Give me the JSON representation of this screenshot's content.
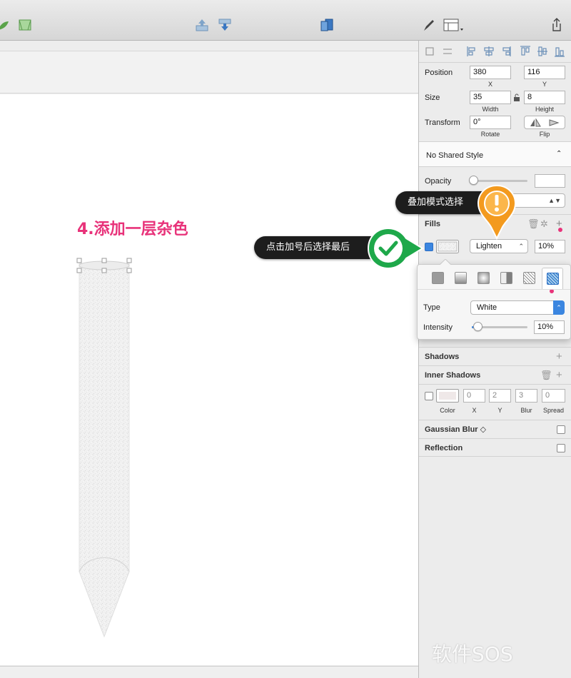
{
  "canvas": {
    "title": "4.添加一层杂色"
  },
  "tooltips": {
    "blend": "叠加模式选择",
    "add": "点击加号后选择最后"
  },
  "inspector": {
    "position": {
      "label": "Position",
      "x": "380",
      "y": "116",
      "x_label": "X",
      "y_label": "Y"
    },
    "size": {
      "label": "Size",
      "width": "35",
      "height": "8",
      "width_label": "Width",
      "height_label": "Height"
    },
    "transform": {
      "label": "Transform",
      "rotate": "0°",
      "rotate_label": "Rotate",
      "flip_label": "Flip"
    },
    "shared_style": "No Shared Style",
    "opacity": {
      "label": "Opacity",
      "value": ""
    },
    "fills": {
      "title": "Fills",
      "blend_mode": "Lighten",
      "opacity": "10%"
    },
    "noise": {
      "type_label": "Type",
      "type_value": "White",
      "intensity_label": "Intensity",
      "intensity_value": "10%",
      "intensity_level": 0.1
    },
    "shadows": {
      "title": "Shadows"
    },
    "inner_shadows": {
      "title": "Inner Shadows",
      "x": "0",
      "y": "2",
      "blur": "3",
      "spread": "0",
      "color_label": "Color",
      "x_label": "X",
      "y_label": "Y",
      "blur_label": "Blur",
      "spread_label": "Spread"
    },
    "gaussian_blur": {
      "title": "Gaussian Blur ◇"
    },
    "reflection": {
      "title": "Reflection"
    }
  },
  "watermark": "软件SOS",
  "colors": {
    "accent_pink": "#e8337a",
    "tip_orange": "#f39a1e",
    "tip_green": "#1ea84a",
    "checkbox_blue": "#3b86e0"
  }
}
